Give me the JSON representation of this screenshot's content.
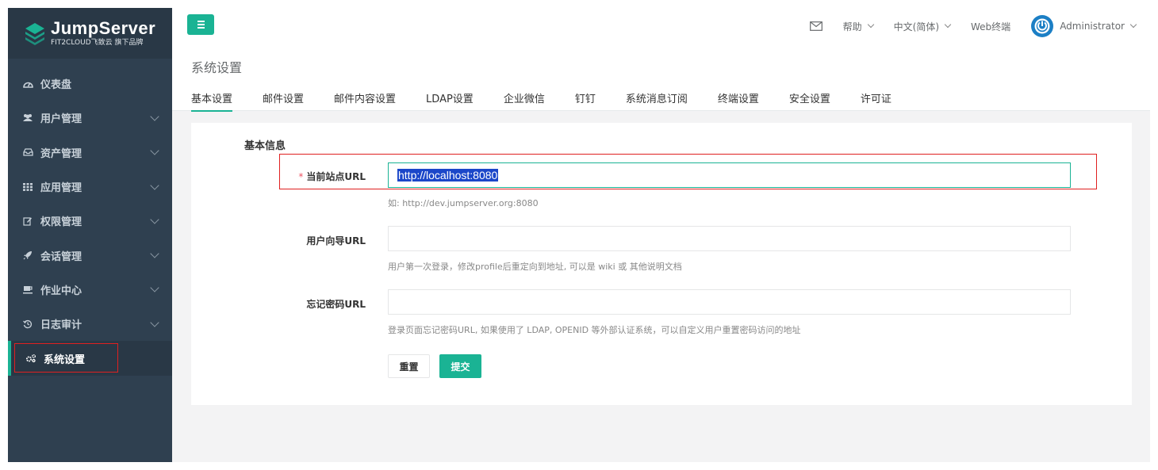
{
  "brand": {
    "title": "JumpServer",
    "subtitle": "FIT2CLOUD飞致云 旗下品牌"
  },
  "sidebar": {
    "items": [
      {
        "label": "仪表盘",
        "icon": "dashboard-icon",
        "has_children": false
      },
      {
        "label": "用户管理",
        "icon": "users-icon",
        "has_children": true
      },
      {
        "label": "资产管理",
        "icon": "inbox-icon",
        "has_children": true
      },
      {
        "label": "应用管理",
        "icon": "grid-icon",
        "has_children": true
      },
      {
        "label": "权限管理",
        "icon": "edit-icon",
        "has_children": true
      },
      {
        "label": "会话管理",
        "icon": "rocket-icon",
        "has_children": true
      },
      {
        "label": "作业中心",
        "icon": "coffee-icon",
        "has_children": true
      },
      {
        "label": "日志审计",
        "icon": "history-icon",
        "has_children": true
      },
      {
        "label": "系统设置",
        "icon": "cogs-icon",
        "has_children": false,
        "active": true
      }
    ]
  },
  "topbar": {
    "help": "帮助",
    "language": "中文(简体)",
    "web_terminal": "Web终端",
    "user": "Administrator"
  },
  "page": {
    "title": "系统设置",
    "tabs": [
      "基本设置",
      "邮件设置",
      "邮件内容设置",
      "LDAP设置",
      "企业微信",
      "钉钉",
      "系统消息订阅",
      "终端设置",
      "安全设置",
      "许可证"
    ],
    "active_tab": "基本设置"
  },
  "form": {
    "section_title": "基本信息",
    "site_url": {
      "label": "当前站点URL",
      "required_mark": "*",
      "value": "http://localhost:8080",
      "help": "如: http://dev.jumpserver.org:8080"
    },
    "user_guide_url": {
      "label": "用户向导URL",
      "value": "",
      "help": "用户第一次登录，修改profile后重定向到地址, 可以是 wiki 或 其他说明文档"
    },
    "forgot_password_url": {
      "label": "忘记密码URL",
      "value": "",
      "help": "登录页面忘记密码URL, 如果使用了 LDAP, OPENID 等外部认证系统，可以自定义用户重置密码访问的地址"
    },
    "reset_label": "重置",
    "submit_label": "提交"
  },
  "colors": {
    "accent": "#1ab394",
    "sidebar": "#2f4050",
    "highlight": "#e02020"
  }
}
